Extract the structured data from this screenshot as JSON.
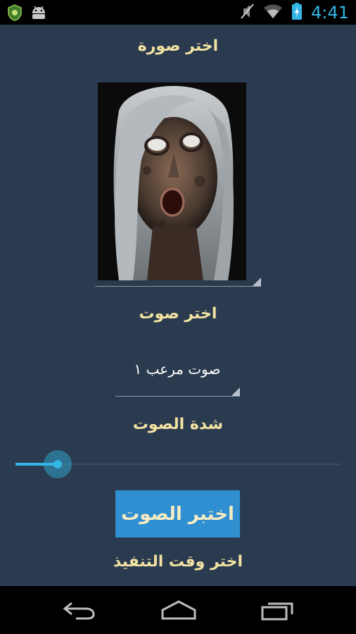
{
  "status_bar": {
    "time": "4:41",
    "left_icons": [
      "shield-app-icon",
      "android-robot-icon"
    ],
    "right_icons": [
      "mute-icon",
      "wifi-icon",
      "battery-charging-icon"
    ]
  },
  "main": {
    "choose_image_label": "اختر صورة",
    "choose_sound_label": "اختر صوت",
    "sound_spinner_value": "صوت مرعب ١",
    "volume_label": "شدة الصوت",
    "volume_level_fraction": 0.13,
    "test_sound_button": "اختبر الصوت",
    "choose_time_label": "اختر وقت التنفيذ"
  },
  "nav_bar": {
    "buttons": [
      "back-icon",
      "home-icon",
      "recent-apps-icon"
    ]
  },
  "colors": {
    "background": "#2b3b4f",
    "heading_text": "#f3e3a3",
    "accent": "#33b5e5",
    "button_bg": "#2f8fd0"
  }
}
